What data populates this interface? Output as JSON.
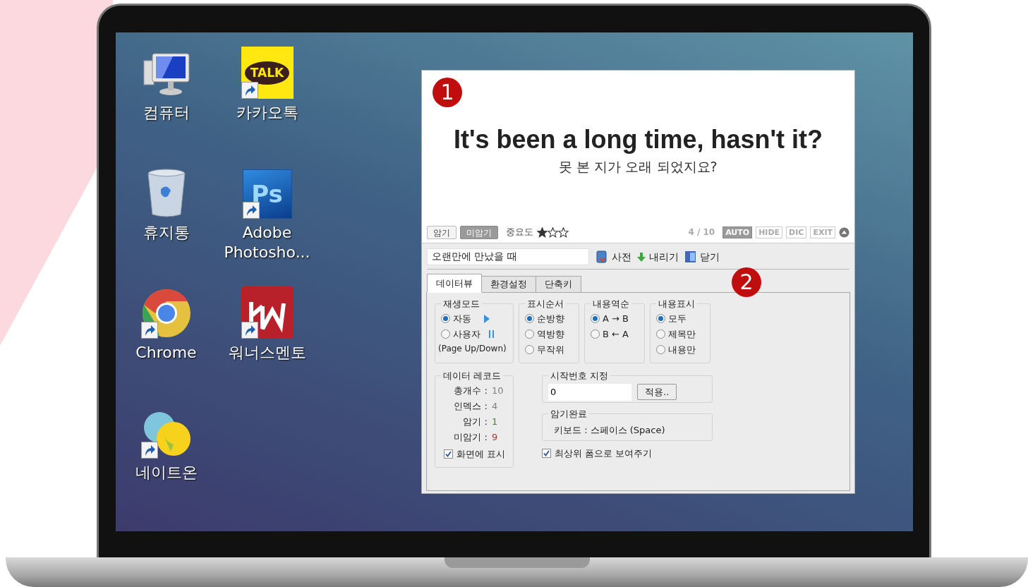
{
  "desktop": {
    "icons": [
      {
        "kind": "computer",
        "label": "컴퓨터",
        "shortcut": false
      },
      {
        "kind": "trash",
        "label": "휴지통",
        "shortcut": false
      },
      {
        "kind": "chrome",
        "label": "Chrome",
        "shortcut": true
      },
      {
        "kind": "bubbles",
        "label": "네이트온",
        "shortcut": true
      },
      {
        "kind": "talk",
        "label": "카카오톡",
        "logo_text": "TALK",
        "shortcut": true
      },
      {
        "kind": "ps",
        "label": "Adobe Photosho...",
        "logo_text": "Ps",
        "shortcut": true
      },
      {
        "kind": "km",
        "label": "워너스멘토",
        "shortcut": true
      }
    ]
  },
  "app": {
    "markers": [
      "1",
      "2"
    ],
    "card": {
      "sentence": "It's been a long time, hasn't it?",
      "translation": "못 본 지가 오래 되었지요?"
    },
    "toolbar": {
      "buttons": [
        {
          "label": "암기",
          "selected": false
        },
        {
          "label": "미암기",
          "selected": true
        }
      ],
      "importance_label": "중요도",
      "stars": 1,
      "counter": "4 / 10",
      "mode_buttons": [
        {
          "label": "AUTO",
          "selected": true
        },
        {
          "label": "HIDE",
          "selected": false
        },
        {
          "label": "DIC",
          "selected": false
        },
        {
          "label": "EXIT",
          "selected": false
        }
      ]
    },
    "title_field": {
      "value": "오랜만에 만났을 때"
    },
    "actions": [
      {
        "kind": "dictionary",
        "label": "사전"
      },
      {
        "kind": "down",
        "label": "내리기"
      },
      {
        "kind": "close",
        "label": "닫기"
      }
    ],
    "tabs": [
      {
        "label": "데이터뷰",
        "selected": true
      },
      {
        "label": "환경설정",
        "selected": false
      },
      {
        "label": "단축키",
        "selected": false
      }
    ],
    "option_groups": [
      {
        "title": "재생모드",
        "options": [
          {
            "label": "자동",
            "selected": true,
            "kind": "play"
          },
          {
            "label": "사용자",
            "selected": false,
            "kind": "pause"
          }
        ],
        "note": "(Page Up/Down)"
      },
      {
        "title": "표시순서",
        "options": [
          {
            "label": "순방향",
            "selected": true
          },
          {
            "label": "역방향",
            "selected": false
          },
          {
            "label": "무작위",
            "selected": false
          }
        ]
      },
      {
        "title": "내용역순",
        "options": [
          {
            "label": "A → B",
            "selected": true
          },
          {
            "label": "B ← A",
            "selected": false
          }
        ]
      },
      {
        "title": "내용표시",
        "options": [
          {
            "label": "모두",
            "selected": true
          },
          {
            "label": "제목만",
            "selected": false
          },
          {
            "label": "내용만",
            "selected": false
          }
        ]
      }
    ],
    "data_record": {
      "title": "데이터 레코드",
      "rows": [
        {
          "label": "총개수 :",
          "value": "10",
          "color": "#808080"
        },
        {
          "label": "인덱스 :",
          "value": "4",
          "color": "#808080"
        },
        {
          "label": "암기 :",
          "value": "1",
          "color": "#2e8b3a"
        },
        {
          "label": "미암기 :",
          "value": "9",
          "color": "#c0302a"
        }
      ],
      "checkbox": {
        "label": "화면에 표시",
        "checked": true
      }
    },
    "start_number": {
      "title": "시작번호 지정",
      "value": "0",
      "button": "적용.."
    },
    "memorize_done": {
      "title": "암기완료",
      "text": "키보드 : 스페이스 (Space)"
    },
    "topmost": {
      "label": "최상위 폼으로 보여주기",
      "checked": true
    }
  }
}
